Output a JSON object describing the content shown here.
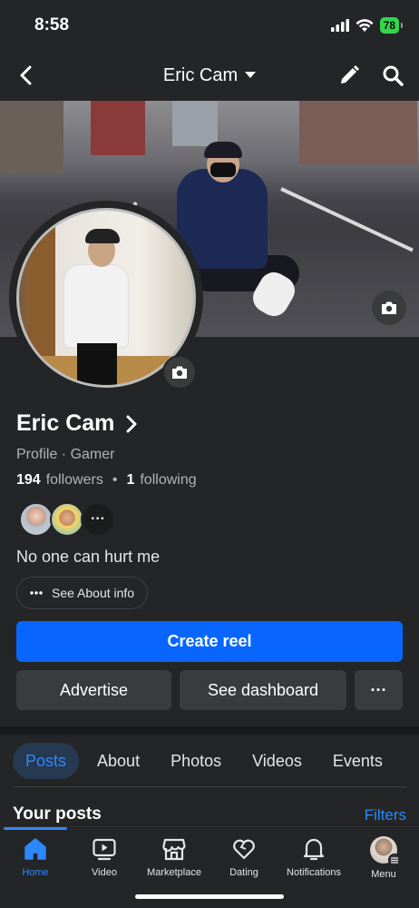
{
  "status": {
    "time": "8:58",
    "battery": "78"
  },
  "header": {
    "title": "Eric Cam"
  },
  "profile": {
    "name": "Eric Cam",
    "subtitle": "Profile · Gamer",
    "followers_count": "194",
    "followers_label": "followers",
    "separator": "•",
    "following_count": "1",
    "following_label": "following",
    "friends_more": "···",
    "bio": "No one can hurt me",
    "about_label": "See About info"
  },
  "actions": {
    "create_reel": "Create reel",
    "advertise": "Advertise",
    "dashboard": "See dashboard",
    "more": "···"
  },
  "tabs": [
    {
      "label": "Posts",
      "active": true
    },
    {
      "label": "About"
    },
    {
      "label": "Photos"
    },
    {
      "label": "Videos"
    },
    {
      "label": "Events"
    }
  ],
  "posts_section": {
    "title": "Your posts",
    "filters": "Filters"
  },
  "bottom_nav": [
    {
      "label": "Home",
      "icon": "home-icon",
      "active": true
    },
    {
      "label": "Video",
      "icon": "video-icon"
    },
    {
      "label": "Marketplace",
      "icon": "marketplace-icon"
    },
    {
      "label": "Dating",
      "icon": "dating-icon"
    },
    {
      "label": "Notifications",
      "icon": "bell-icon"
    },
    {
      "label": "Menu",
      "icon": "avatar"
    }
  ],
  "colors": {
    "accent": "#0866ff",
    "link": "#2d88ff",
    "background": "#242526",
    "button": "#3a3b3c"
  }
}
